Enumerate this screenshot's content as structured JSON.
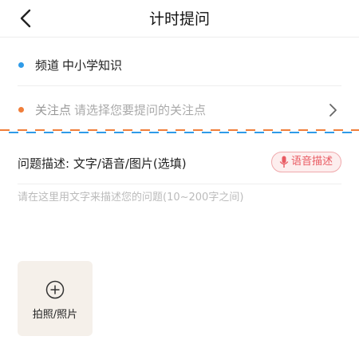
{
  "header": {
    "title": "计时提问"
  },
  "channel": {
    "label": "频道",
    "value": "中小学知识",
    "dot_color": "#2f9be8"
  },
  "focus": {
    "label": "关注点",
    "placeholder": "请选择您要提问的关注点",
    "dot_color": "#f07e3a"
  },
  "divider_colors": [
    "#f07e3a",
    "#2f9be8"
  ],
  "description": {
    "label": "问题描述: 文字/语音/图片(选填)",
    "voice_button": "语音描述",
    "placeholder": "请在这里用文字来描述您的问题(10~200字之间)"
  },
  "photo": {
    "label": "拍照/照片"
  },
  "icons": {
    "back": "back-arrow-icon",
    "chevron": "chevron-right-icon",
    "mic": "microphone-icon",
    "add": "plus-circle-icon"
  }
}
